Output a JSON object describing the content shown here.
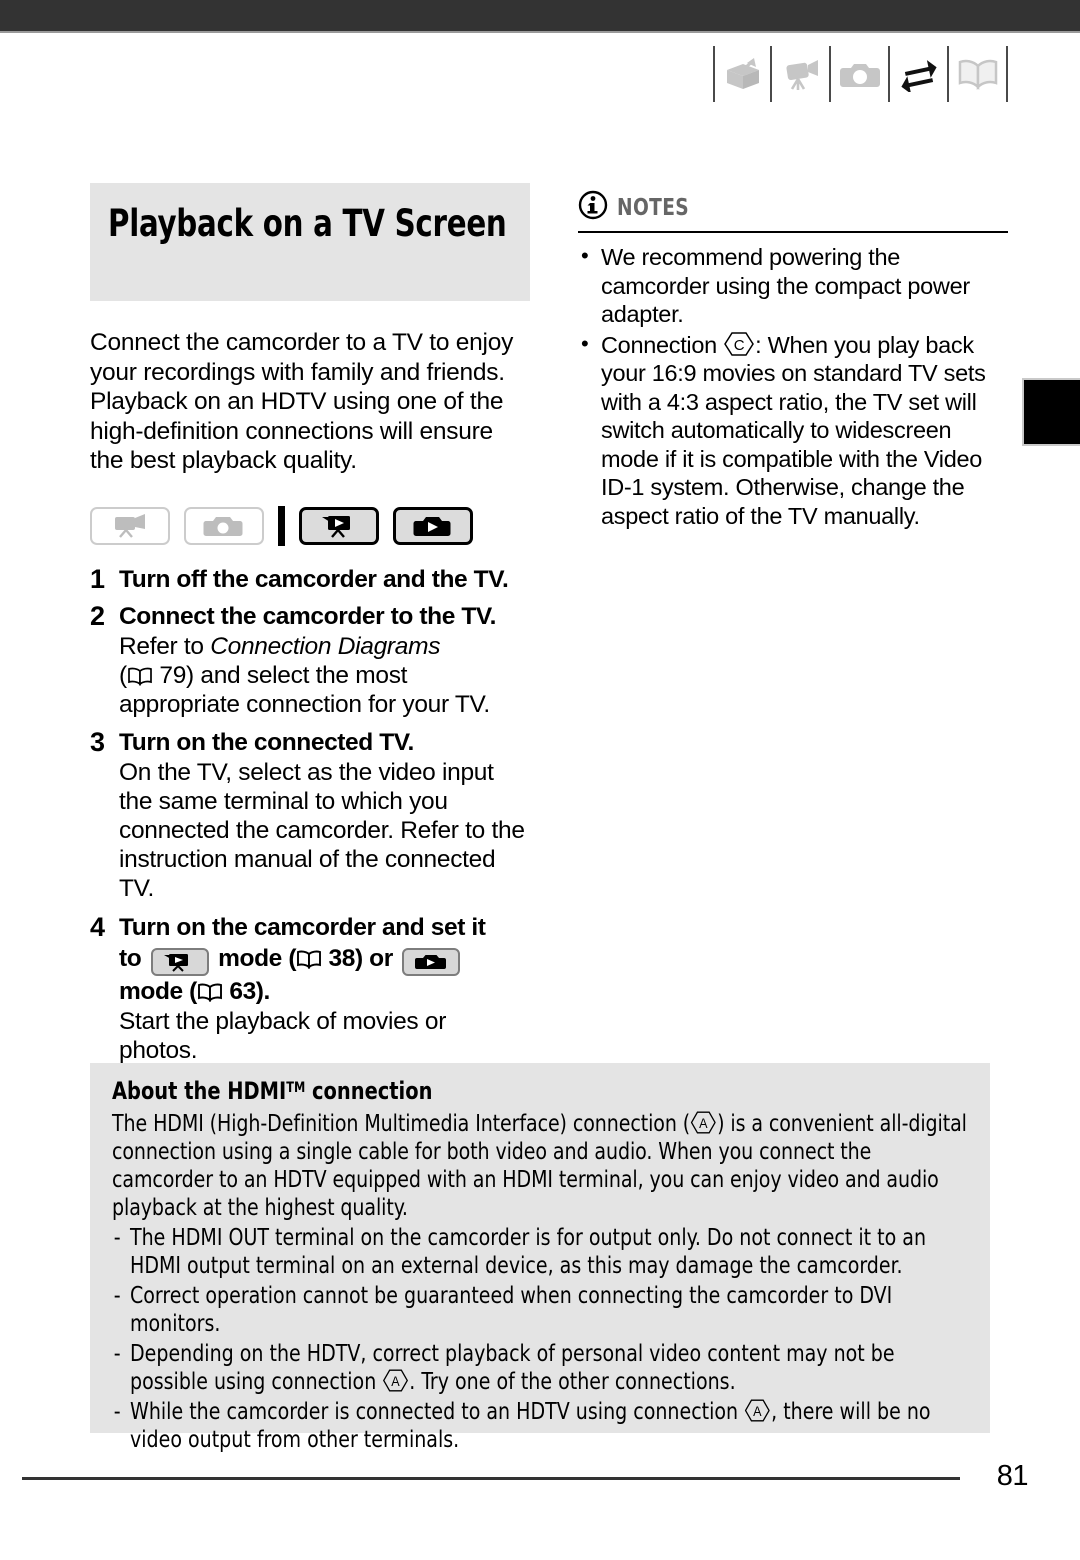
{
  "header": {
    "icons": [
      {
        "name": "unpacking-box-icon",
        "state": "inactive"
      },
      {
        "name": "camcorder-icon",
        "state": "inactive"
      },
      {
        "name": "photo-camera-icon",
        "state": "inactive"
      },
      {
        "name": "exchange-arrows-icon",
        "state": "active"
      },
      {
        "name": "open-book-icon",
        "state": "inactive"
      }
    ]
  },
  "section": {
    "title": "Playback on a TV Screen",
    "intro": "Connect the camcorder to a TV to enjoy your recordings with family and friends. Playback on an HDTV using one of the high-definition connections will ensure the best playback quality."
  },
  "mode_badges": [
    {
      "name": "mode-badge-camcorder-record",
      "state": "inactive"
    },
    {
      "name": "mode-badge-photo-record",
      "state": "inactive"
    },
    {
      "name": "mode-badge-camcorder-playback",
      "state": "active"
    },
    {
      "name": "mode-badge-photo-playback",
      "state": "active"
    }
  ],
  "steps": [
    {
      "number": "1",
      "heading": "Turn off the camcorder and the TV.",
      "body": ""
    },
    {
      "number": "2",
      "heading": "Connect the camcorder to the TV.",
      "body_pre": "Refer to ",
      "body_italic": "Connection Diagrams",
      "body_ref_page": "79",
      "body_post": ") and select the most appropriate connection for your TV."
    },
    {
      "number": "3",
      "heading": "Turn on the connected TV.",
      "body": "On the TV, select as the video input the same terminal to which you connected the camcorder. Refer to the instruction manual of the connected TV."
    },
    {
      "number": "4",
      "heading_a": "Turn on the camcorder and set it",
      "heading_to": "to",
      "heading_mode1": "mode (",
      "ref_page_1": "38",
      "heading_or": ") or",
      "heading_mode2": "mode (",
      "ref_page_2": "63",
      "heading_end": ").",
      "body": "Start the playback of movies or photos."
    }
  ],
  "notes": {
    "label": "NOTES",
    "items": [
      {
        "text": "We recommend powering the camcorder using the compact power adapter."
      },
      {
        "pre": "Connection ",
        "marker": "C",
        "post": ": When you play back your 16:9 movies on standard TV sets with a 4:3 aspect ratio, the TV set will switch automatically to widescreen mode if it is compatible with the Video ID-1 system. Otherwise, change the aspect ratio of the TV manually."
      }
    ]
  },
  "hdmi": {
    "title_pre": "About the HDMI",
    "title_sup": "TM",
    "title_post": " connection",
    "para_pre": "The HDMI (High-Definition Multimedia Interface) connection (",
    "para_marker": "A",
    "para_post": ") is a convenient all-digital connection using a single cable for both video and audio. When you connect the camcorder to an HDTV equipped with an HDMI terminal, you can enjoy video and audio playback at the highest quality.",
    "bullets": [
      {
        "text": "The HDMI OUT terminal on the camcorder is for output only. Do not connect it to an HDMI output terminal on an external device, as this may damage the camcorder."
      },
      {
        "text": "Correct operation cannot be guaranteed when connecting the camcorder to DVI monitors."
      },
      {
        "pre": "Depending on the HDTV, correct playback of personal video content may not be possible using connection ",
        "marker": "A",
        "post": ". Try one of the other connections."
      },
      {
        "pre": "While the camcorder is connected to an HDTV using connection ",
        "marker": "A",
        "post": ", there will be no video output from other terminals."
      }
    ]
  },
  "footer": {
    "page_number": "81"
  },
  "colors": {
    "topbar": "#333333",
    "block_gray": "#e4e4e4",
    "notes_label": "#666666",
    "icon_inactive": "#c6c6c6",
    "icon_active": "#111111"
  }
}
